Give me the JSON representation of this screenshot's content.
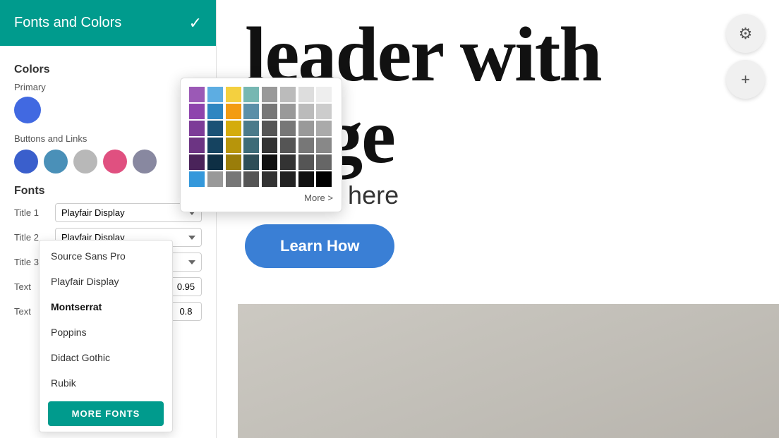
{
  "sidebar": {
    "title": "Fonts and Colors",
    "checkmark": "✓",
    "colors": {
      "section_label": "Colors",
      "primary_label": "Primary",
      "primary_color": "#4169e1",
      "buttons_links_label": "Buttons and  Links",
      "swatches": [
        {
          "color": "#3a5fcc",
          "name": "blue-dark"
        },
        {
          "color": "#4a90b8",
          "name": "blue-medium"
        },
        {
          "color": "#b0b0b0",
          "name": "gray"
        },
        {
          "color": "#e05080",
          "name": "pink"
        },
        {
          "color": "#888899",
          "name": "gray-dark"
        }
      ]
    },
    "fonts": {
      "section_label": "Fonts",
      "rows": [
        {
          "label": "Title 1",
          "font": "Playfair Display",
          "size": null
        },
        {
          "label": "Title 2",
          "font": "Playfair Display",
          "size": null
        },
        {
          "label": "Title 3",
          "font": "Montserrat",
          "size": null
        },
        {
          "label": "Text",
          "font": "",
          "size": "0.95"
        },
        {
          "label": "Text",
          "font": "",
          "size": "0.8"
        }
      ]
    }
  },
  "color_picker": {
    "colors": [
      "#9b59b6",
      "#5dade2",
      "#f4d03f",
      "#76b7b2",
      "#999",
      "#bbb",
      "#ddd",
      "#eee",
      "#8e44ad",
      "#2e86c1",
      "#f39c12",
      "#5b8fa8",
      "#777",
      "#999",
      "#bbb",
      "#ccc",
      "#7d3c98",
      "#1a5276",
      "#d4ac0d",
      "#4a7a8a",
      "#555",
      "#777",
      "#999",
      "#aaa",
      "#6c3483",
      "#154360",
      "#b7950b",
      "#3d6b77",
      "#333",
      "#555",
      "#777",
      "#888",
      "#4a235a",
      "#0e2f44",
      "#9a7d0a",
      "#2e4e57",
      "#111",
      "#333",
      "#555",
      "#666",
      "#3498db",
      "#999999",
      "#777777",
      "#555555",
      "#333333",
      "#222222",
      "#111111",
      "#000000"
    ],
    "more_label": "More >"
  },
  "dropdown": {
    "items": [
      {
        "label": "Source Sans Pro",
        "selected": false
      },
      {
        "label": "Playfair Display",
        "selected": false
      },
      {
        "label": "Montserrat",
        "selected": true
      },
      {
        "label": "Poppins",
        "selected": false
      },
      {
        "label": "Didact Gothic",
        "selected": false
      },
      {
        "label": "Rubik",
        "selected": false
      }
    ],
    "more_fonts_label": "MORE FONTS"
  },
  "hero": {
    "heading_part1": "leader with",
    "heading_part2": "nage",
    "subtitle": "r subtitle here",
    "cta_label": "Learn How"
  },
  "toolbar": {
    "gear_icon": "⚙",
    "plus_icon": "+"
  }
}
